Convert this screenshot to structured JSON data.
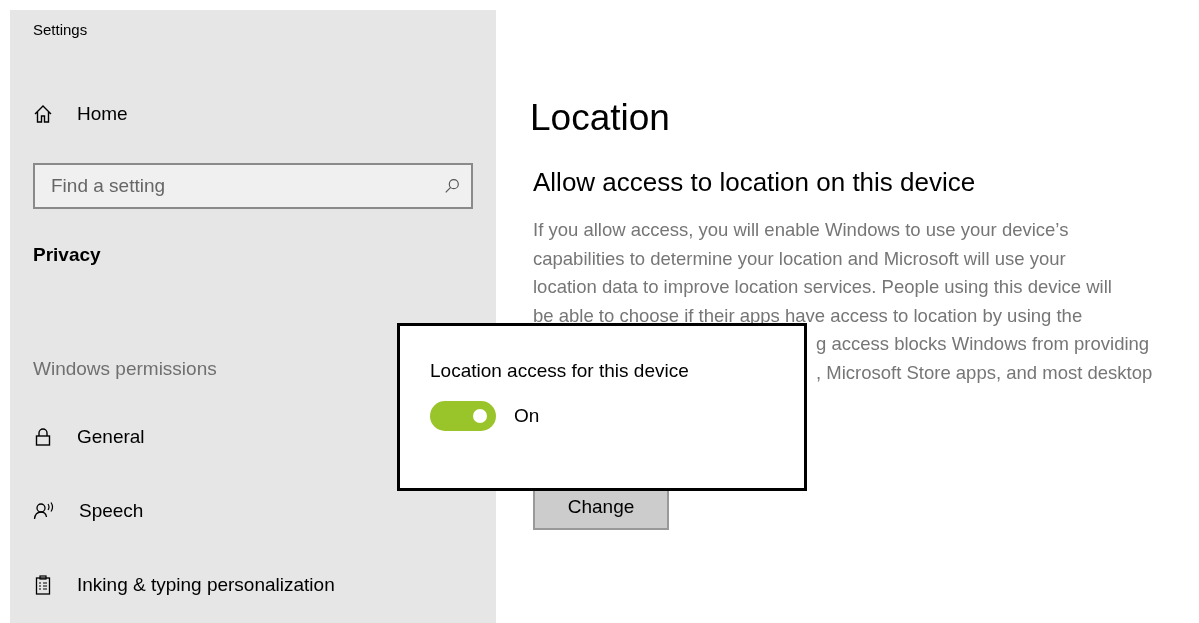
{
  "window": {
    "title": "Settings"
  },
  "sidebar": {
    "home": "Home",
    "search": {
      "placeholder": "Find a setting"
    },
    "section": "Privacy",
    "group": "Windows permissions",
    "items": [
      {
        "label": "General"
      },
      {
        "label": "Speech"
      },
      {
        "label": "Inking & typing personalization"
      }
    ]
  },
  "main": {
    "title": "Location",
    "heading": "Allow access to location on this device",
    "paragraph_lines": [
      "If you allow access, you will enable Windows to use your device’s",
      "capabilities to determine your location and Microsoft will use your",
      "location data to improve location services. People using this device will",
      "be able to choose if their apps have access to location by using the"
    ],
    "paragraph_fragments": [
      "g access blocks Windows from providing",
      ", Microsoft Store apps, and most desktop"
    ],
    "button": "Change"
  },
  "popup": {
    "title": "Location access for this device",
    "toggle": {
      "on": true,
      "label": "On"
    }
  }
}
